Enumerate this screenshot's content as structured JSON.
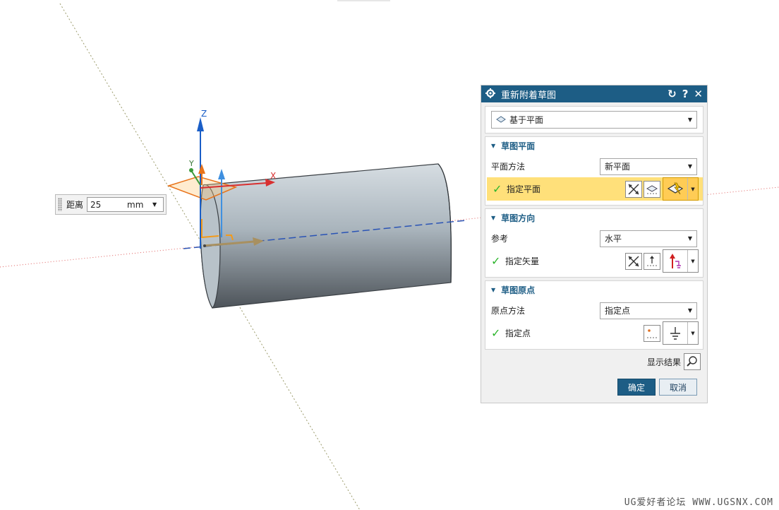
{
  "viewport": {
    "axes": {
      "z": "Z",
      "x": "X",
      "y": "Y"
    },
    "distance": {
      "label": "距离",
      "value": "25",
      "unit": "mm"
    }
  },
  "dialog": {
    "title": "重新附着草图",
    "type_select": "基于平面",
    "section_plane": {
      "title": "草图平面",
      "method_label": "平面方法",
      "method_value": "新平面",
      "specify_label": "指定平面"
    },
    "section_direction": {
      "title": "草图方向",
      "reference_label": "参考",
      "reference_value": "水平",
      "specify_label": "指定矢量"
    },
    "section_origin": {
      "title": "草图原点",
      "method_label": "原点方法",
      "method_value": "指定点",
      "specify_label": "指定点"
    },
    "show_result_label": "显示结果",
    "ok_label": "确定",
    "cancel_label": "取消"
  },
  "watermark": "UG爱好者论坛 WWW.UGSNX.COM",
  "colors": {
    "accent": "#1d5d85",
    "highlight": "#ffe07a",
    "check": "#2db52d"
  }
}
